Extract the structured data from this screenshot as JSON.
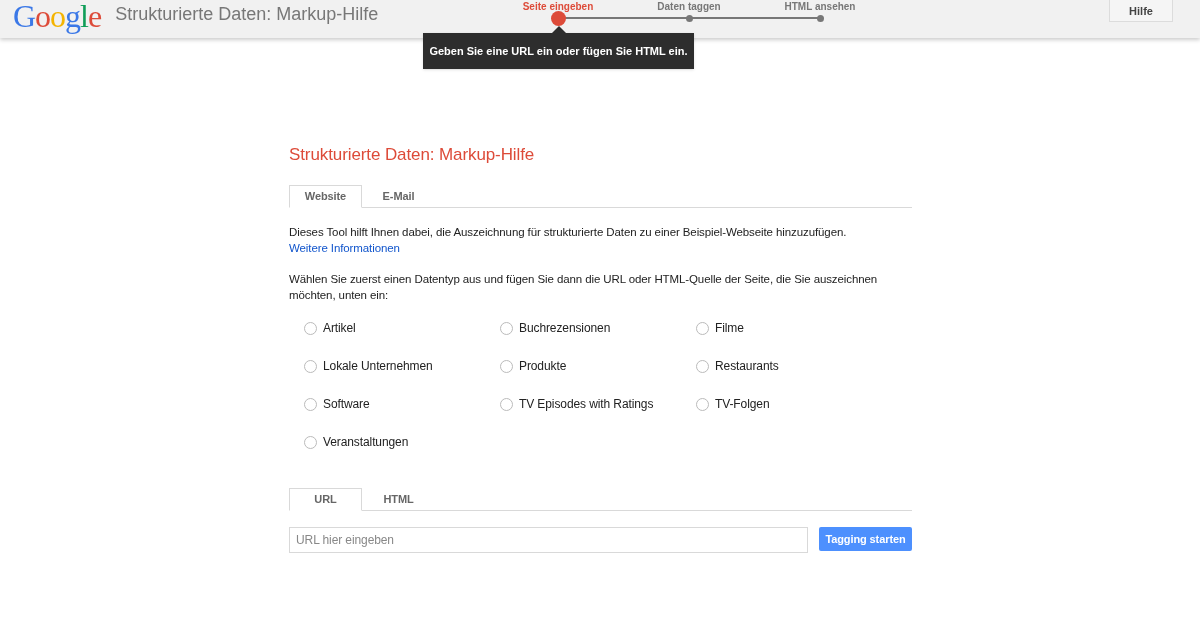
{
  "header": {
    "logo": "Google",
    "title": "Strukturierte Daten: Markup-Hilfe",
    "steps": [
      {
        "label": "Seite eingeben",
        "selected": true
      },
      {
        "label": "Daten taggen",
        "selected": false
      },
      {
        "label": "HTML ansehen",
        "selected": false
      }
    ],
    "tooltip": "Geben Sie eine URL ein oder fügen Sie HTML ein.",
    "help_button": "Hilfe"
  },
  "main": {
    "heading": "Strukturierte Daten: Markup-Hilfe",
    "tabs": [
      {
        "label": "Website",
        "selected": true
      },
      {
        "label": "E-Mail",
        "selected": false
      }
    ],
    "intro": "Dieses Tool hilft Ihnen dabei, die Auszeichnung für strukturierte Daten zu einer Beispiel-Webseite hinzuzufügen.",
    "intro_link": "Weitere Informationen",
    "instruction": "Wählen Sie zuerst einen Datentyp aus und fügen Sie dann die URL oder HTML-Quelle der Seite, die Sie auszeichnen möchten, unten ein:",
    "data_types": [
      {
        "label": "Artikel",
        "selected": false
      },
      {
        "label": "Buchrezensionen",
        "selected": false
      },
      {
        "label": "Filme",
        "selected": false
      },
      {
        "label": "Lokale Unternehmen",
        "selected": false
      },
      {
        "label": "Produkte",
        "selected": false
      },
      {
        "label": "Restaurants",
        "selected": false
      },
      {
        "label": "Software",
        "selected": false
      },
      {
        "label": "TV Episodes with Ratings",
        "selected": false
      },
      {
        "label": "TV-Folgen",
        "selected": false
      },
      {
        "label": "Veranstaltungen",
        "selected": false
      }
    ],
    "source_tabs": [
      {
        "label": "URL",
        "selected": true
      },
      {
        "label": "HTML",
        "selected": false
      }
    ],
    "url_field": {
      "placeholder": "URL hier eingeben"
    },
    "submit_button": "Tagging starten"
  }
}
